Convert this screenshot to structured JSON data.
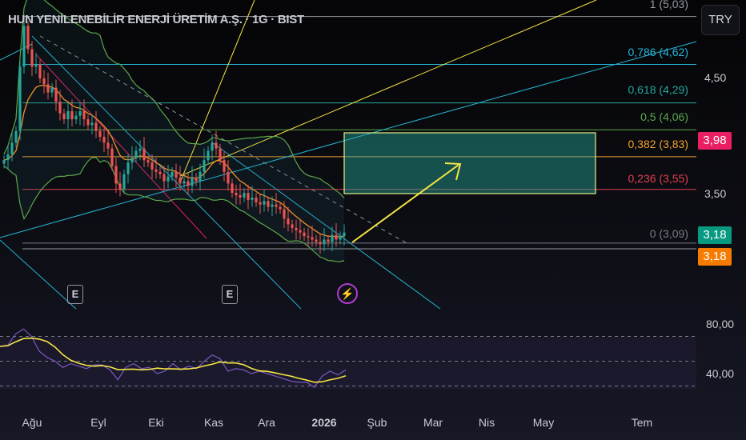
{
  "header": {
    "title": "HUN YENİLENEBİLİR ENERJİ ÜRETİM A.Ş. · 1G · BIST",
    "currency_button": "TRY"
  },
  "colors": {
    "up": "#26a69a",
    "down": "#ef5350",
    "rsi": "#7e57c2",
    "rsi_ma": "#f5e642",
    "bb": "#5ca84a",
    "ema": "#f0902a"
  },
  "chart_data": {
    "type": "candlestick",
    "title": "HUN YENİLENEBİLİR ENERJİ ÜRETİM A.Ş. · 1G · BIST",
    "ylim": [
      2.6,
      5.1
    ],
    "y_ticks": [
      "4,50",
      "3,50"
    ],
    "x_ticks": [
      "Ağu",
      "Eyl",
      "Eki",
      "Kas",
      "Ara",
      "2026",
      "Şub",
      "Mar",
      "Nis",
      "May",
      "Tem"
    ],
    "closes": [
      3.8,
      3.85,
      3.95,
      4.05,
      4.6,
      4.95,
      4.75,
      4.6,
      4.62,
      4.5,
      4.45,
      4.38,
      4.42,
      4.3,
      4.2,
      4.15,
      4.22,
      4.15,
      4.18,
      4.22,
      4.15,
      4.1,
      4.12,
      4.05,
      4.0,
      3.95,
      3.9,
      3.75,
      3.6,
      3.55,
      3.68,
      3.78,
      3.82,
      3.88,
      3.9,
      3.8,
      3.78,
      3.72,
      3.7,
      3.68,
      3.62,
      3.66,
      3.7,
      3.65,
      3.6,
      3.62,
      3.58,
      3.65,
      3.62,
      3.7,
      3.8,
      3.88,
      3.95,
      3.9,
      3.8,
      3.7,
      3.6,
      3.52,
      3.5,
      3.48,
      3.52,
      3.46,
      3.48,
      3.44,
      3.42,
      3.45,
      3.4,
      3.42,
      3.4,
      3.38,
      3.3,
      3.25,
      3.22,
      3.2,
      3.18,
      3.15,
      3.14,
      3.12,
      3.1,
      3.08,
      3.12,
      3.1,
      3.16,
      3.12,
      3.15,
      3.18
    ],
    "price_tags": [
      {
        "value": "3,98",
        "color": "#e91e63"
      },
      {
        "value": "3,18",
        "color": "#089981"
      },
      {
        "value": "3,18",
        "color": "#f57c00"
      }
    ],
    "fib_levels": [
      {
        "label": "1 (5,03)",
        "price": 5.03,
        "color": "#9598a1"
      },
      {
        "label": "0,786 (4,62)",
        "price": 4.62,
        "color": "#26b5d6"
      },
      {
        "label": "0,618 (4,29)",
        "price": 4.29,
        "color": "#26a69a"
      },
      {
        "label": "0,5 (4,06)",
        "price": 4.06,
        "color": "#5ca84a"
      },
      {
        "label": "0,382 (3,83)",
        "price": 3.83,
        "color": "#f0a030"
      },
      {
        "label": "0,236 (3,55)",
        "price": 3.55,
        "color": "#e04050"
      },
      {
        "label": "0 (3,09)",
        "price": 3.09,
        "color": "#787b86"
      }
    ],
    "events": [
      "E",
      "E"
    ],
    "rsi": {
      "y_ticks": [
        "80,00",
        "40,00"
      ],
      "levels": [
        70,
        50,
        30
      ],
      "ylim": [
        10,
        90
      ],
      "values": [
        62,
        63,
        72,
        76,
        70,
        58,
        53,
        50,
        45,
        48,
        46,
        44,
        47,
        47,
        43,
        35,
        45,
        48,
        44,
        45,
        40,
        42,
        48,
        43,
        46,
        44,
        50,
        55,
        52,
        42,
        44,
        43,
        40,
        42,
        40,
        38,
        36,
        34,
        33,
        33,
        29,
        38,
        42,
        39,
        43
      ]
    }
  }
}
